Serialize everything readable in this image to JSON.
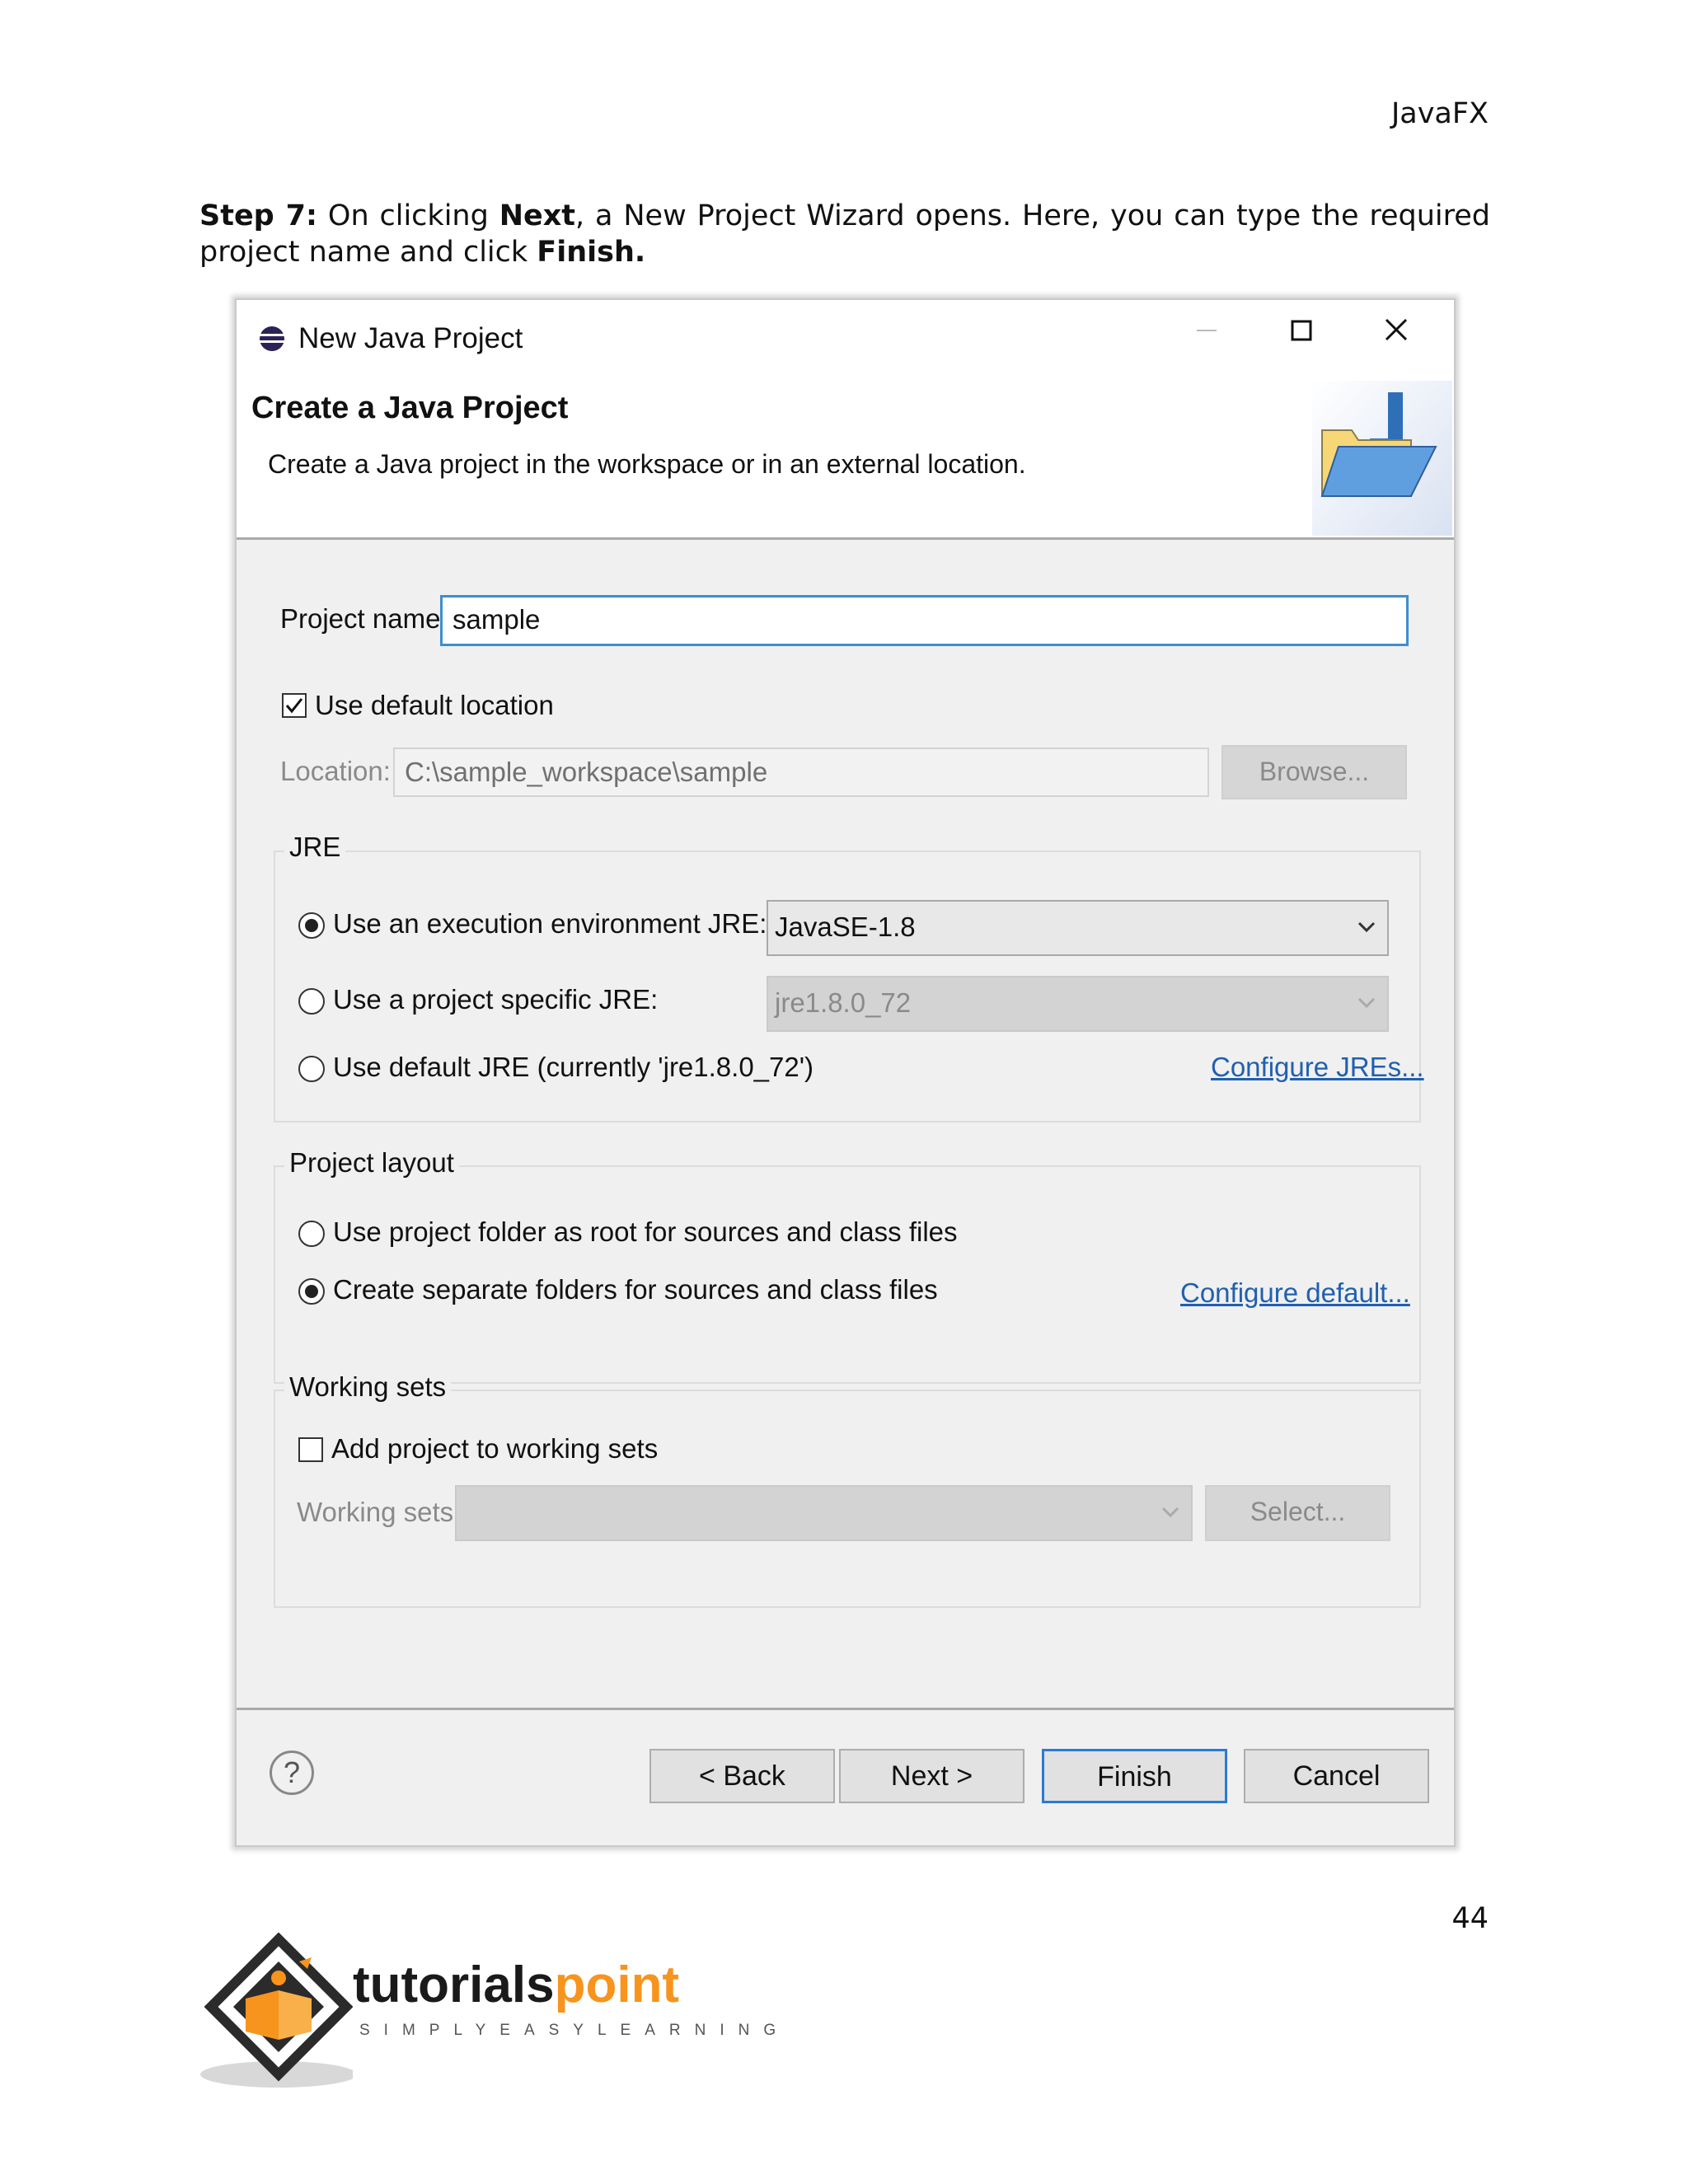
{
  "page": {
    "header": "JavaFX",
    "step_label": "Step 7:",
    "step_text_1": " On clicking ",
    "step_next": "Next",
    "step_text_2": ", a New Project Wizard opens. Here, you can type the required project name and click ",
    "step_finish": "Finish.",
    "page_number": "44"
  },
  "dialog": {
    "title": "New Java Project",
    "window_controls": [
      "minimize-icon",
      "maximize-icon",
      "close-icon"
    ],
    "banner_title": "Create a Java Project",
    "banner_desc": "Create a Java project in the workspace or in an external location.",
    "project_name_label": "Project name:",
    "project_name_value": "sample",
    "use_default_location_label": "Use default location",
    "use_default_location_checked": true,
    "location_label": "Location:",
    "location_value": "C:\\sample_workspace\\sample",
    "browse_label": "Browse...",
    "jre": {
      "group_title": "JRE",
      "opt1_label": "Use an execution environment JRE:",
      "opt1_value": "JavaSE-1.8",
      "opt2_label": "Use a project specific JRE:",
      "opt2_value": "jre1.8.0_72",
      "opt3_label": "Use default JRE (currently 'jre1.8.0_72')",
      "configure_link": "Configure JREs...",
      "selected": 1
    },
    "layout": {
      "group_title": "Project layout",
      "opt1_label": "Use project folder as root for sources and class files",
      "opt2_label": "Create separate folders for sources and class files",
      "configure_link": "Configure default...",
      "selected": 2
    },
    "working_sets": {
      "group_title": "Working sets",
      "add_label": "Add project to working sets",
      "add_checked": false,
      "sets_label": "Working sets:",
      "sets_value": "",
      "select_label": "Select..."
    },
    "buttons": {
      "back": "< Back",
      "next": "Next >",
      "finish": "Finish",
      "cancel": "Cancel",
      "help": "?"
    }
  },
  "logo": {
    "brand_main": "tutorials",
    "brand_accent": "point",
    "tagline": "SIMPLYEASYLEARNING",
    "accent_color": "#f7941d"
  }
}
